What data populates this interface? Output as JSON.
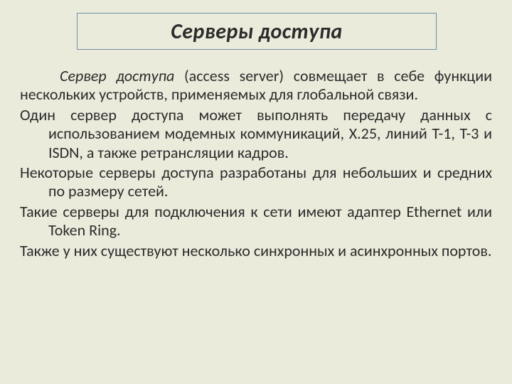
{
  "title": "Серверы доступа",
  "p1_term": "Сервер доступа",
  "p1_rest": " (access server) совмещает в себе функции нескольких устройств, применяемых для глобальной связи.",
  "p2": "Один сервер доступа может выполнять передачу данных с использованием модемных коммуникаций, X.25, линий T-1, T-3 и ISDN, а также ретрансляции кадров.",
  "p3": "Некоторые серверы доступа разработаны для небольших и средних по размеру сетей.",
  "p4": "Такие серверы для подключения к сети имеют адаптер Ethernet или Token Ring.",
  "p5": "Также у них существуют несколько синхронных и асинхронных портов."
}
